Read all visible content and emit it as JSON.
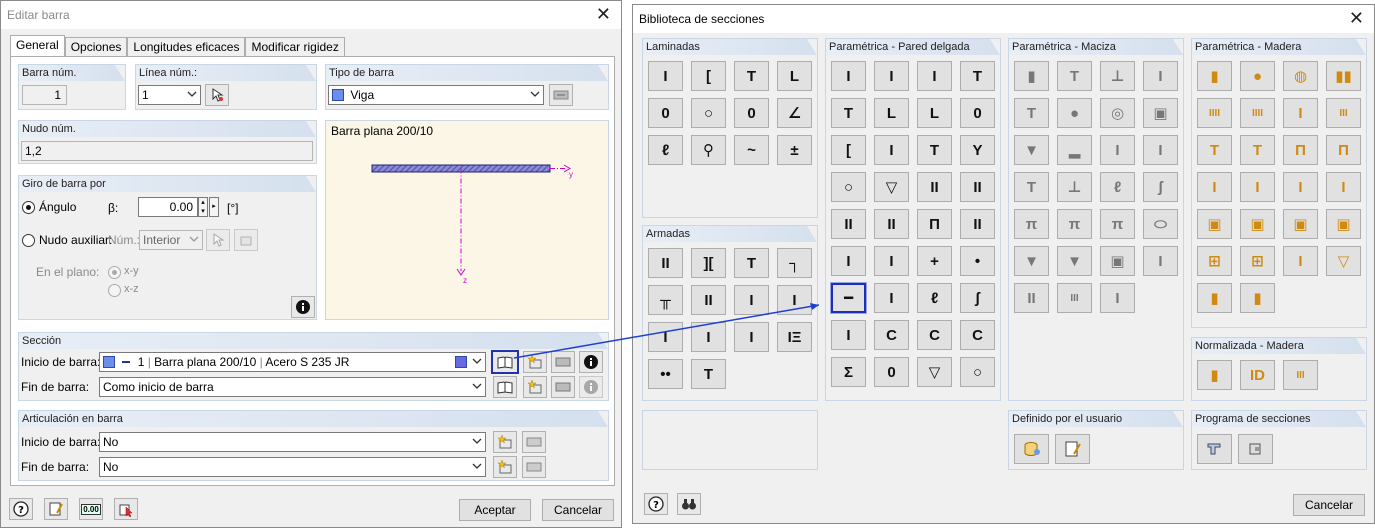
{
  "left_dialog": {
    "title": "Editar barra",
    "tabs": [
      "General",
      "Opciones",
      "Longitudes eficaces",
      "Modificar rigidez"
    ],
    "barra_num": {
      "label": "Barra núm.",
      "value": "1"
    },
    "linea_num": {
      "label": "Línea núm.:",
      "value": "1"
    },
    "tipo_barra": {
      "label": "Tipo de barra",
      "value": "Viga"
    },
    "nudo_num": {
      "label": "Nudo núm.",
      "value": "1,2"
    },
    "preview": {
      "caption": "Barra plana 200/10",
      "y_axis": "y",
      "z_axis": "z"
    },
    "giro": {
      "label": "Giro de barra por",
      "angulo_label": "Ángulo",
      "beta_label": "β:",
      "beta_value": "0.00",
      "unit": "[°]",
      "nudo_aux_label": "Nudo auxiliar:",
      "num_label": "Núm.:",
      "num_value": "Interior",
      "en_plano_label": "En el plano:",
      "plane_xy": "x-y",
      "plane_xz": "x-z"
    },
    "seccion": {
      "label": "Sección",
      "inicio_label": "Inicio de barra:",
      "inicio_num": "1",
      "inicio_name": "Barra plana 200/10",
      "inicio_material": "Acero S 235 JR",
      "fin_label": "Fin de barra:",
      "fin_value": "Como inicio de barra"
    },
    "articulacion": {
      "label": "Articulación en barra",
      "inicio_label": "Inicio de barra:",
      "inicio_value": "No",
      "fin_label": "Fin de barra:",
      "fin_value": "No"
    },
    "footer": {
      "accept": "Aceptar",
      "cancel": "Cancelar",
      "units_icon_text": "0.00"
    }
  },
  "right_dialog": {
    "title": "Biblioteca de secciones",
    "groups": {
      "laminadas": "Laminadas",
      "armadas": "Armadas",
      "pared_delgada": "Paramétrica - Pared delgada",
      "maciza": "Paramétrica - Maciza",
      "madera": "Paramétrica - Madera",
      "normalizada": "Normalizada - Madera",
      "usuario": "Definido por el usuario",
      "programa": "Programa de secciones"
    },
    "laminadas_icons": [
      "I",
      "[",
      "T",
      "L",
      "0",
      "○",
      "0",
      "∠",
      "ℓ",
      "⚲",
      "~",
      "±"
    ],
    "armadas_icons": [
      "II",
      "][",
      "T",
      "┐",
      "╥",
      "II",
      "I",
      "I",
      "I",
      "I",
      "I",
      "IΞ",
      "••",
      "T"
    ],
    "pared_icons": [
      "I",
      "I",
      "I",
      "T",
      "T",
      "L",
      "L",
      "0",
      "[",
      "I",
      "T",
      "Y",
      "○",
      "▽",
      "II",
      "II",
      "II",
      "II",
      "П",
      "II",
      "I",
      "I",
      "+",
      "•",
      "━",
      "I",
      "ℓ",
      "ʃ",
      "I",
      "C",
      "C",
      "C",
      "Σ",
      "0",
      "▽",
      "○"
    ],
    "maciza_icons": [
      "▮",
      "T",
      "⊥",
      "I",
      "T",
      "●",
      "◎",
      "▣",
      "▼",
      "▂",
      "I",
      "I",
      "T",
      "⊥",
      "ℓ",
      "ʃ",
      "π",
      "π",
      "π",
      "⬭",
      "▼",
      "▼",
      "▣",
      "I",
      "II",
      "III",
      "I"
    ],
    "madera_icons": [
      "▮",
      "●",
      "◍",
      "▮▮",
      "IIII",
      "IIII",
      "I",
      "III",
      "T",
      "T",
      "П",
      "П",
      "I",
      "I",
      "I",
      "I",
      "▣",
      "▣",
      "▣",
      "▣",
      "⊞",
      "⊞",
      "I",
      "▽",
      "▮",
      "▮"
    ],
    "normalizada_icons": [
      "▮",
      "ID",
      "III"
    ],
    "footer": {
      "cancel": "Cancelar"
    }
  }
}
